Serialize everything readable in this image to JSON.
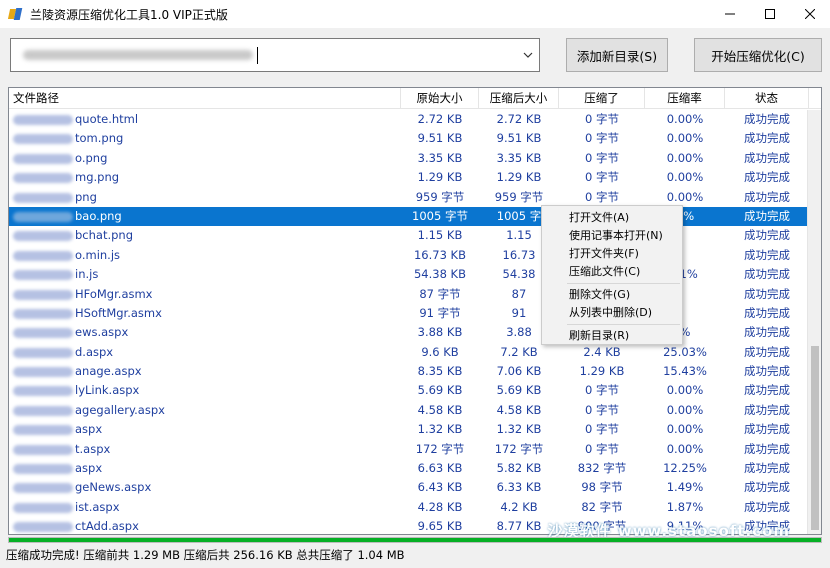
{
  "window": {
    "title": "兰陵资源压缩优化工具1.0 VIP正式版",
    "accent": "#0a75cf"
  },
  "toolbar": {
    "path_value": "",
    "add_dir_label": "添加新目录(S)",
    "start_label": "开始压缩优化(C)"
  },
  "table": {
    "columns": [
      "文件路径",
      "原始大小",
      "压缩后大小",
      "压缩了",
      "压缩率",
      "状态"
    ],
    "rows": [
      {
        "path": "quote.html",
        "orig": "2.72 KB",
        "comp": "2.72 KB",
        "saved": "0 字节",
        "rate": "0.00%",
        "status": "成功完成"
      },
      {
        "path": "tom.png",
        "orig": "9.51 KB",
        "comp": "9.51 KB",
        "saved": "0 字节",
        "rate": "0.00%",
        "status": "成功完成"
      },
      {
        "path": "o.png",
        "orig": "3.35 KB",
        "comp": "3.35 KB",
        "saved": "0 字节",
        "rate": "0.00%",
        "status": "成功完成"
      },
      {
        "path": "mg.png",
        "orig": "1.29 KB",
        "comp": "1.29 KB",
        "saved": "0 字节",
        "rate": "0.00%",
        "status": "成功完成"
      },
      {
        "path": "png",
        "orig": "959 字节",
        "comp": "959 字节",
        "saved": "0 字节",
        "rate": "0.00%",
        "status": "成功完成"
      },
      {
        "path": "bao.png",
        "orig": "1005 字节",
        "comp": "1005 字",
        "saved": "",
        "rate": "0%",
        "status": "成功完成"
      },
      {
        "path": "bchat.png",
        "orig": "1.15 KB",
        "comp": "1.15",
        "saved": "",
        "rate": "",
        "status": "成功完成"
      },
      {
        "path": "o.min.js",
        "orig": "16.73 KB",
        "comp": "16.73",
        "saved": "",
        "rate": "",
        "status": "成功完成"
      },
      {
        "path": "in.js",
        "orig": "54.38 KB",
        "comp": "54.38",
        "saved": "",
        "rate": "01%",
        "status": "成功完成"
      },
      {
        "path": "HFoMgr.asmx",
        "orig": "87 字节",
        "comp": "87",
        "saved": "",
        "rate": "",
        "status": "成功完成"
      },
      {
        "path": "HSoftMgr.asmx",
        "orig": "91 字节",
        "comp": "91",
        "saved": "",
        "rate": "",
        "status": "成功完成"
      },
      {
        "path": "ews.aspx",
        "orig": "3.88 KB",
        "comp": "3.88",
        "saved": "",
        "rate": "%",
        "status": "成功完成"
      },
      {
        "path": "d.aspx",
        "orig": "9.6 KB",
        "comp": "7.2 KB",
        "saved": "2.4 KB",
        "rate": "25.03%",
        "status": "成功完成"
      },
      {
        "path": "anage.aspx",
        "orig": "8.35 KB",
        "comp": "7.06 KB",
        "saved": "1.29 KB",
        "rate": "15.43%",
        "status": "成功完成"
      },
      {
        "path": "lyLink.aspx",
        "orig": "5.69 KB",
        "comp": "5.69 KB",
        "saved": "0 字节",
        "rate": "0.00%",
        "status": "成功完成"
      },
      {
        "path": "agegallery.aspx",
        "orig": "4.58 KB",
        "comp": "4.58 KB",
        "saved": "0 字节",
        "rate": "0.00%",
        "status": "成功完成"
      },
      {
        "path": "aspx",
        "orig": "1.32 KB",
        "comp": "1.32 KB",
        "saved": "0 字节",
        "rate": "0.00%",
        "status": "成功完成"
      },
      {
        "path": "t.aspx",
        "orig": "172 字节",
        "comp": "172 字节",
        "saved": "0 字节",
        "rate": "0.00%",
        "status": "成功完成"
      },
      {
        "path": "aspx",
        "orig": "6.63 KB",
        "comp": "5.82 KB",
        "saved": "832 字节",
        "rate": "12.25%",
        "status": "成功完成"
      },
      {
        "path": "geNews.aspx",
        "orig": "6.43 KB",
        "comp": "6.33 KB",
        "saved": "98 字节",
        "rate": "1.49%",
        "status": "成功完成"
      },
      {
        "path": "ist.aspx",
        "orig": "4.28 KB",
        "comp": "4.2 KB",
        "saved": "82 字节",
        "rate": "1.87%",
        "status": "成功完成"
      },
      {
        "path": "ctAdd.aspx",
        "orig": "9.65 KB",
        "comp": "8.77 KB",
        "saved": "900 字节",
        "rate": "9.11%",
        "status": "成功完成"
      }
    ],
    "selected_index": 5
  },
  "context_menu": {
    "items": [
      "打开文件(A)",
      "使用记事本打开(N)",
      "打开文件夹(F)",
      "压缩此文件(C)",
      "删除文件(G)",
      "从列表中删除(D)",
      "刷新目录(R)"
    ]
  },
  "progress": {
    "fraction": 1.0,
    "color": "#06b025"
  },
  "status": {
    "text": "压缩成功完成!  压缩前共 1.29 MB 压缩后共 256.16 KB 总共压缩了 1.04 MB"
  },
  "watermark": "沙漠软件 www.staosoft.com"
}
